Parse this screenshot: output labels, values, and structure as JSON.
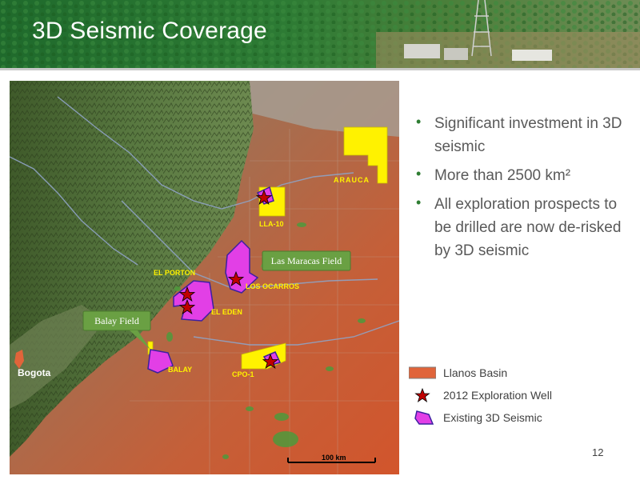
{
  "header": {
    "title": "3D Seismic Coverage"
  },
  "bullets": [
    {
      "text": "Significant investment in 3D seismic"
    },
    {
      "text": "More than 2500 km²"
    },
    {
      "text": "All exploration prospects to be drilled are now de-risked by 3D seismic"
    }
  ],
  "map": {
    "labels": {
      "arauca": "ARAUCA",
      "lla10": "LLA-10",
      "el_porton": "EL PORTON",
      "los_ocarros": "LOS OCARROS",
      "el_eden": "EL EDEN",
      "balay": "BALAY",
      "cpo1": "CPO-1",
      "bogota": "Bogota"
    },
    "callouts": {
      "las_maracas": "Las Maracas Field",
      "balay_field": "Balay Field"
    },
    "scale_label": "100 km",
    "colors": {
      "basin": "#e0643a",
      "seismic": "#e23fe6",
      "block": "#fff200",
      "well_star": "#c00000",
      "callout": "#6aa043"
    }
  },
  "legend": {
    "basin": "Llanos Basin",
    "well": "2012 Exploration Well",
    "seismic": "Existing 3D Seismic"
  },
  "page_number": "12"
}
